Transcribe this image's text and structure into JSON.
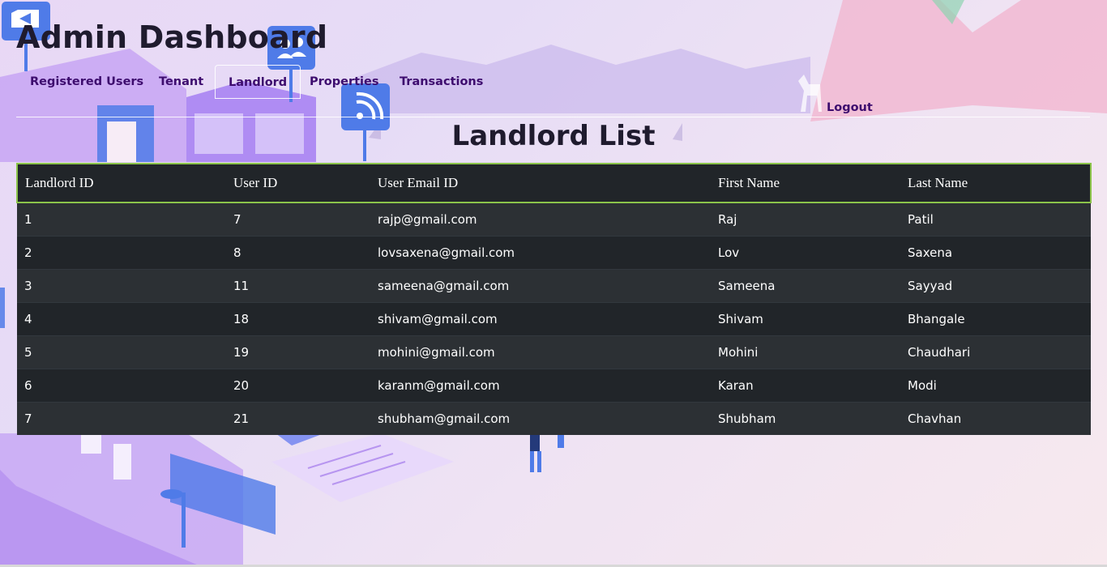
{
  "header": {
    "title": "Admin Dashboard"
  },
  "nav": {
    "tabs": [
      {
        "label": "Registered Users",
        "active": false
      },
      {
        "label": "Tenant",
        "active": false
      },
      {
        "label": "Landlord",
        "active": true
      },
      {
        "label": "Properties",
        "active": false
      },
      {
        "label": "Transactions",
        "active": false
      }
    ],
    "logout_label": "Logout"
  },
  "page": {
    "title": "Landlord List"
  },
  "table": {
    "columns": [
      "Landlord ID",
      "User ID",
      "User Email ID",
      "First Name",
      "Last Name"
    ],
    "rows": [
      [
        "1",
        "7",
        "rajp@gmail.com",
        "Raj",
        "Patil"
      ],
      [
        "2",
        "8",
        "lovsaxena@gmail.com",
        "Lov",
        "Saxena"
      ],
      [
        "3",
        "11",
        "sameena@gmail.com",
        "Sameena",
        "Sayyad"
      ],
      [
        "4",
        "18",
        "shivam@gmail.com",
        "Shivam",
        "Bhangale"
      ],
      [
        "5",
        "19",
        "mohini@gmail.com",
        "Mohini",
        "Chaudhari"
      ],
      [
        "6",
        "20",
        "karanm@gmail.com",
        "Karan",
        "Modi"
      ],
      [
        "7",
        "21",
        "shubham@gmail.com",
        "Shubham",
        "Chavhan"
      ]
    ]
  },
  "colors": {
    "nav_text": "#3d0c6e",
    "table_header_bg": "#212529",
    "table_header_border": "#8bc34a",
    "row_odd": "#2c3034",
    "row_even": "#212529"
  },
  "icons": [
    "video-icon",
    "users-icon",
    "rss-icon"
  ]
}
